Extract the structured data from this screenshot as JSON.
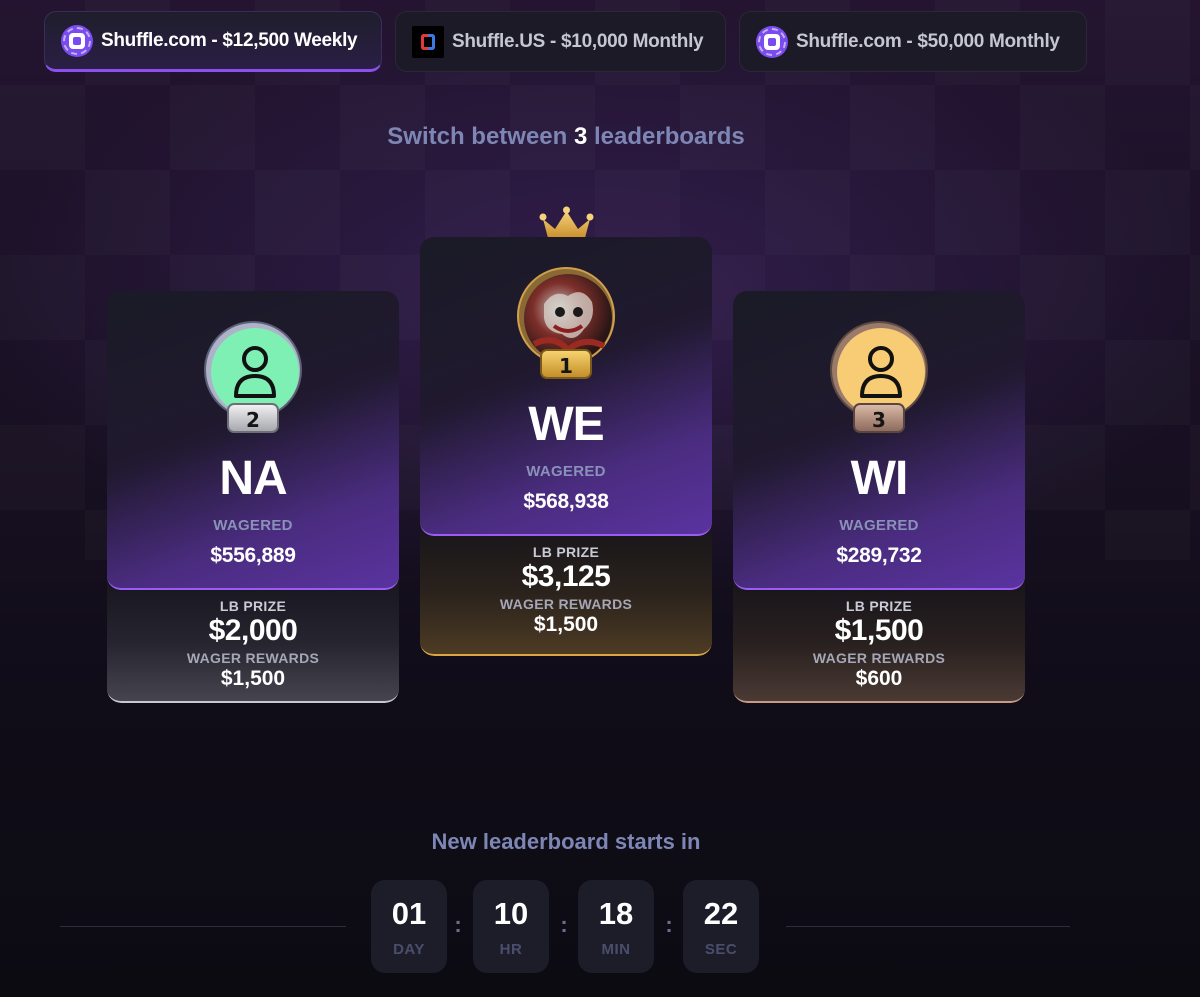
{
  "tabs": [
    {
      "label": "Shuffle.com - $12,500 Weekly",
      "icon": "shuffle-chip-icon",
      "active": true
    },
    {
      "label": "Shuffle.US - $10,000 Monthly",
      "icon": "shuffle-us-icon",
      "active": false
    },
    {
      "label": "Shuffle.com - $50,000 Monthly",
      "icon": "shuffle-chip-icon",
      "active": false
    }
  ],
  "switch_text": {
    "prefix": "Switch between ",
    "count": "3",
    "suffix": " leaderboards"
  },
  "podium": [
    {
      "rank": "2",
      "name": "NA",
      "wagered_label": "WAGERED",
      "wagered": "$556,889",
      "prize_label": "LB PRIZE",
      "prize": "$2,000",
      "rewards_label": "WAGER REWARDS",
      "rewards": "$1,500",
      "avatar_color": "#7ff0b4"
    },
    {
      "rank": "1",
      "name": "WE",
      "wagered_label": "WAGERED",
      "wagered": "$568,938",
      "prize_label": "LB PRIZE",
      "prize": "$3,125",
      "rewards_label": "WAGER REWARDS",
      "rewards": "$1,500",
      "avatar_color": "#3a1f23"
    },
    {
      "rank": "3",
      "name": "WI",
      "wagered_label": "WAGERED",
      "wagered": "$289,732",
      "prize_label": "LB PRIZE",
      "prize": "$1,500",
      "rewards_label": "WAGER REWARDS",
      "rewards": "$600",
      "avatar_color": "#f8cc74"
    }
  ],
  "countdown": {
    "title": "New leaderboard starts in",
    "units": [
      {
        "value": "01",
        "label": "DAY"
      },
      {
        "value": "10",
        "label": "HR"
      },
      {
        "value": "18",
        "label": "MIN"
      },
      {
        "value": "22",
        "label": "SEC"
      }
    ],
    "separator": ":"
  },
  "colors": {
    "accent": "#9a5cf5",
    "gold": "#d9a640",
    "silver": "#c8c8cf",
    "bronze": "#c69a84",
    "muted_text": "#7d86b4"
  }
}
